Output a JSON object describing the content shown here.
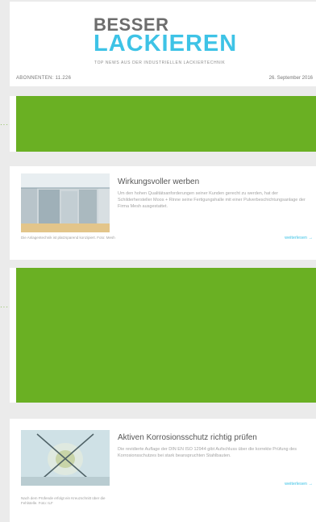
{
  "header": {
    "logo_line1": "BESSER",
    "logo_line2": "LACKIEREN",
    "tagline": "TOP NEWS AUS DER INDUSTRIELLEN LACKIERTECHNIK",
    "subscribers": "ABONNENTEN: 11.226",
    "date": "26. September 2016"
  },
  "articles": [
    {
      "title": "Wirkungsvoller werben",
      "teaser": "Um den hohen Qualitätsanforderungen seiner Kunden gerecht zu werden, hat der Schilderhersteller Moos + Rinne seine Fertigungshalle mit einer Pulverbeschichtungsanlage der Firma Mesh ausgestattet.",
      "caption": "Die Anlagentechnik ist platzsparend konzipiert. Foto: Mesh",
      "more": "weiterlesen →"
    },
    {
      "title": "Aktiven Korrosionsschutz richtig prüfen",
      "teaser": "Die revidierte Auflage der DIN EN ISO 12944 gibt Aufschluss über die korrekte Prüfung des Korrosionsschutzes bei stark beanspruchten Stahlbauten.",
      "caption": "Nach dem Prüfende erfolgt ein Kreuzschnitt über die Fehlstelle. Foto: ILF",
      "more": "weiterlesen →"
    }
  ],
  "markers": {
    "dots": "·····"
  },
  "colors": {
    "ad_green": "#6ab023",
    "accent_blue": "#3ec3e6",
    "logo_gray": "#6d6d6d"
  }
}
